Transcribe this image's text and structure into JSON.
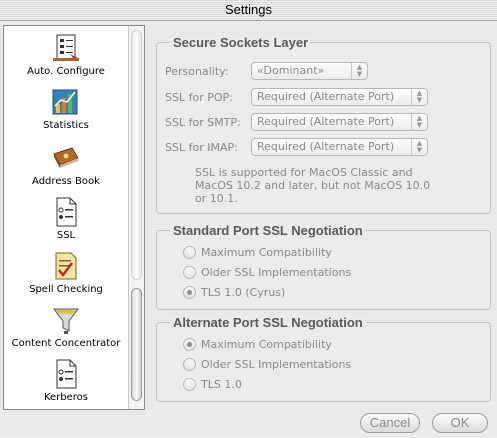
{
  "window": {
    "title": "Settings"
  },
  "sidebar": {
    "items": [
      {
        "label": "Auto. Configure",
        "icon": "auto-configure-icon"
      },
      {
        "label": "Statistics",
        "icon": "statistics-icon"
      },
      {
        "label": "Address Book",
        "icon": "address-book-icon"
      },
      {
        "label": "SSL",
        "icon": "ssl-icon"
      },
      {
        "label": "Spell Checking",
        "icon": "spell-checking-icon"
      },
      {
        "label": "Content Concentrator",
        "icon": "content-concentrator-icon"
      },
      {
        "label": "Kerberos",
        "icon": "kerberos-icon"
      }
    ]
  },
  "ssl_group": {
    "title": "Secure Sockets Layer",
    "personality_label": "Personality:",
    "personality_value": "«Dominant»",
    "pop_label": "SSL for POP:",
    "pop_value": "Required (Alternate Port)",
    "smtp_label": "SSL for SMTP:",
    "smtp_value": "Required (Alternate Port)",
    "imap_label": "SSL for IMAP:",
    "imap_value": "Required (Alternate Port)",
    "note_line1": "SSL is supported for MacOS Classic and",
    "note_line2": "MacOS 10.2 and later, but not MacOS 10.0",
    "note_line3": "or 10.1."
  },
  "standard_group": {
    "title": "Standard Port SSL Negotiation",
    "options": [
      {
        "label": "Maximum Compatibility",
        "selected": false
      },
      {
        "label": "Older SSL Implementations",
        "selected": false
      },
      {
        "label": "TLS 1.0 (Cyrus)",
        "selected": true
      }
    ]
  },
  "alternate_group": {
    "title": "Alternate Port SSL Negotiation",
    "options": [
      {
        "label": "Maximum Compatibility",
        "selected": true
      },
      {
        "label": "Older SSL Implementations",
        "selected": false
      },
      {
        "label": "TLS 1.0",
        "selected": false
      }
    ]
  },
  "buttons": {
    "cancel": "Cancel",
    "ok": "OK"
  }
}
